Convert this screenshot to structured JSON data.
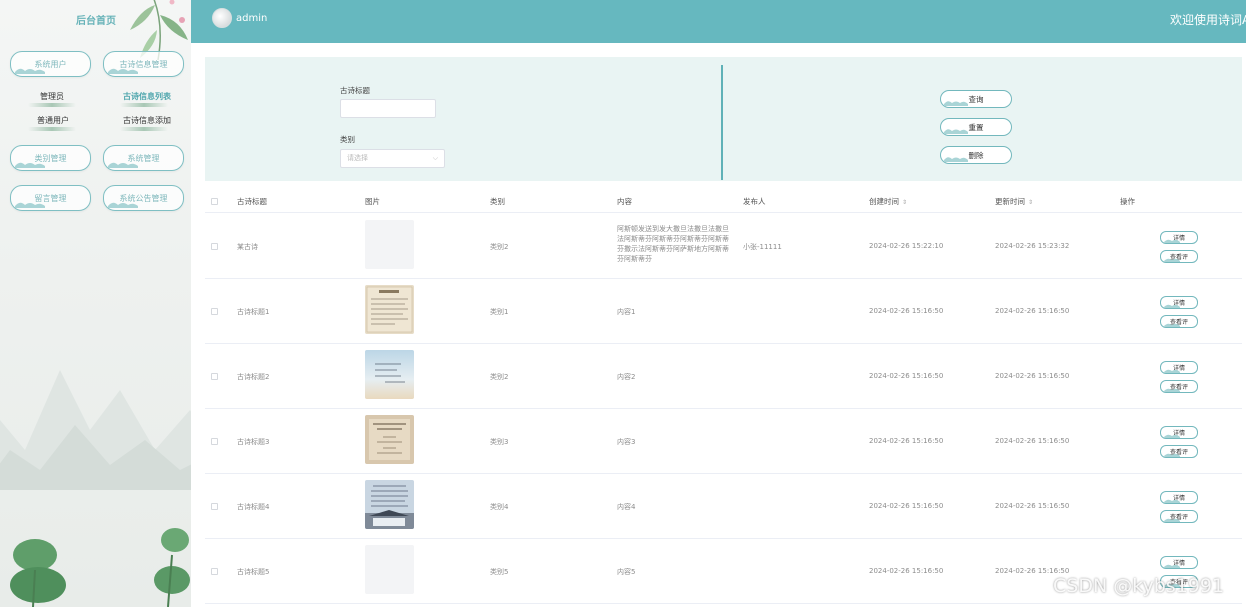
{
  "sidebar": {
    "home": "后台首页",
    "menus": [
      {
        "label": "系统用户"
      },
      {
        "label": "古诗信息管理"
      },
      {
        "label": "类别管理"
      },
      {
        "label": "系统管理"
      },
      {
        "label": "留言管理"
      },
      {
        "label": "系统公告管理"
      }
    ],
    "submenus": [
      {
        "label": "管理员"
      },
      {
        "label": "普通用户"
      },
      {
        "label": "古诗信息列表"
      },
      {
        "label": "古诗信息添加"
      }
    ]
  },
  "header": {
    "username": "admin",
    "welcome": "欢迎使用诗词A"
  },
  "search": {
    "title_label": "古诗标题",
    "title_value": "",
    "category_label": "类别",
    "category_placeholder": "请选择",
    "query_label": "查询",
    "reset_label": "重置",
    "delete_label": "删除"
  },
  "table": {
    "columns": [
      "古诗标题",
      "图片",
      "类别",
      "内容",
      "发布人",
      "创建时间",
      "更新时间",
      "操作"
    ],
    "rows": [
      {
        "title": "某古诗",
        "category": "类别2",
        "content": "阿斯顿发送到发大撒旦法撒旦法撒旦法阿斯蒂芬阿斯蒂芬阿斯蒂芬阿斯蒂芬撒示法阿斯蒂芬阿萨斯地方阿斯蒂芬阿斯蒂芬",
        "publisher": "小张-11111",
        "created": "2024-02-26 15:22:10",
        "updated": "2024-02-26 15:23:32",
        "image": "blank"
      },
      {
        "title": "古诗标题1",
        "category": "类别1",
        "content": "内容1",
        "publisher": "",
        "created": "2024-02-26 15:16:50",
        "updated": "2024-02-26 15:16:50",
        "image": "parchment"
      },
      {
        "title": "古诗标题2",
        "category": "类别2",
        "content": "内容2",
        "publisher": "",
        "created": "2024-02-26 15:16:50",
        "updated": "2024-02-26 15:16:50",
        "image": "sky"
      },
      {
        "title": "古诗标题3",
        "category": "类别3",
        "content": "内容3",
        "publisher": "",
        "created": "2024-02-26 15:16:50",
        "updated": "2024-02-26 15:16:50",
        "image": "scroll"
      },
      {
        "title": "古诗标题4",
        "category": "类别4",
        "content": "内容4",
        "publisher": "",
        "created": "2024-02-26 15:16:50",
        "updated": "2024-02-26 15:16:50",
        "image": "building"
      },
      {
        "title": "古诗标题5",
        "category": "类别5",
        "content": "内容5",
        "publisher": "",
        "created": "2024-02-26 15:16:50",
        "updated": "2024-02-26 15:16:50",
        "image": "blank"
      }
    ],
    "detail_label": "详情",
    "comments_label": "查看评"
  },
  "watermark": "CSDN @kybs1991",
  "colors": {
    "header": "#66b8bf",
    "accent": "#4fa6ad",
    "panel": "#e9f4f3"
  }
}
